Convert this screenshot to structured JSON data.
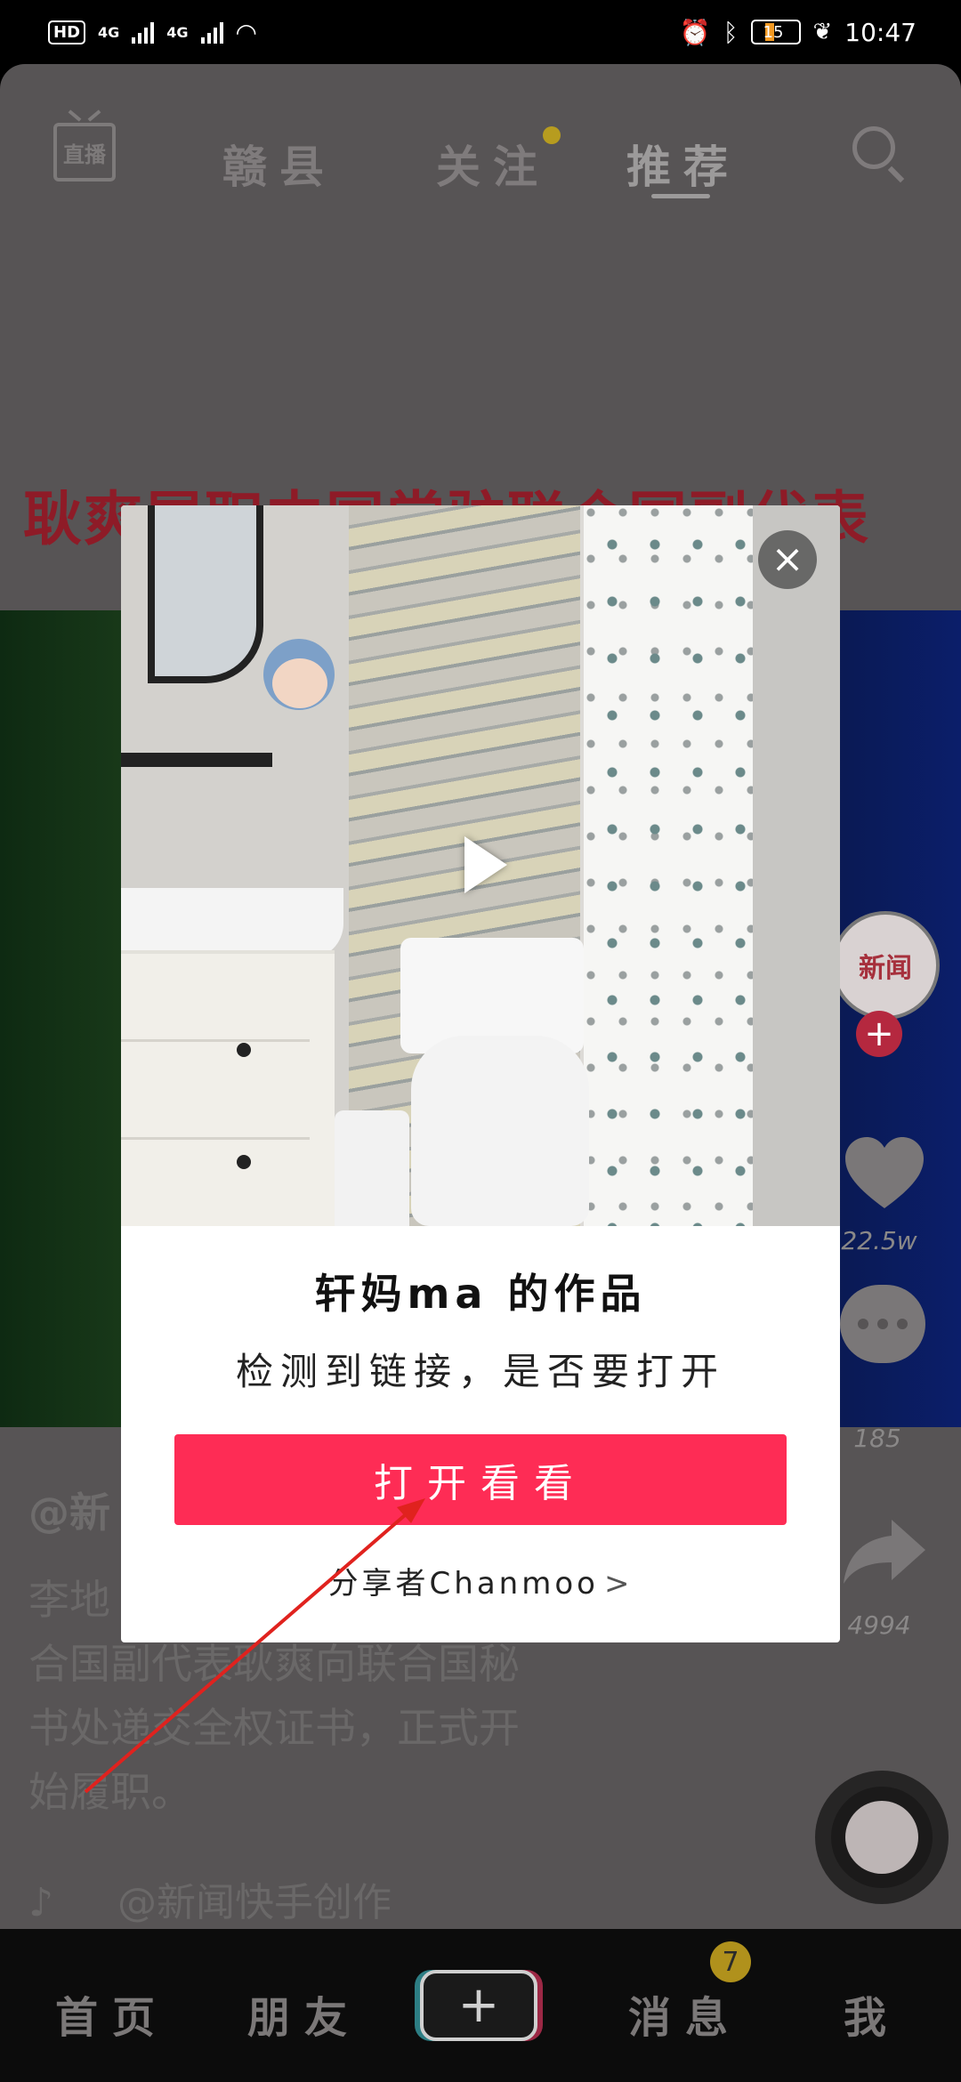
{
  "status_bar": {
    "hd": "HD",
    "net1": "4G",
    "net2": "4G",
    "battery": "15",
    "time": "10:47"
  },
  "top_nav": {
    "live": "直播",
    "tabs": [
      "赣县",
      "关注",
      "推荐"
    ],
    "active_tab": "推荐"
  },
  "headline": "耿爽履职中国常驻联合国副代表",
  "right_rail": {
    "avatar_text": "新闻",
    "likes": "22.5w",
    "comments": "185",
    "shares": "4994"
  },
  "caption": {
    "author": "@新",
    "text": "李地…合国副代表耿爽向联合国秘书处递交全权证书，正式开始履职。",
    "line1": "李地",
    "line2": "合国副代表耿爽向联合国秘",
    "line3": "书处递交全权证书，正式开",
    "line4": "始履职。",
    "music": "@新闻快手创作"
  },
  "bottom_nav": {
    "home": "首页",
    "friends": "朋友",
    "add": "+",
    "messages": "消息",
    "messages_badge": "7",
    "me": "我"
  },
  "modal": {
    "close": "×",
    "title": "轩妈ma 的作品",
    "subtitle": "检测到链接，是否要打开",
    "open_button": "打开看看",
    "sharer": "分享者Chanmoo",
    "chevron": ">"
  },
  "colors": {
    "accent": "#fe2c55",
    "overlay_bg": "#575455",
    "badge": "#b0911c"
  }
}
